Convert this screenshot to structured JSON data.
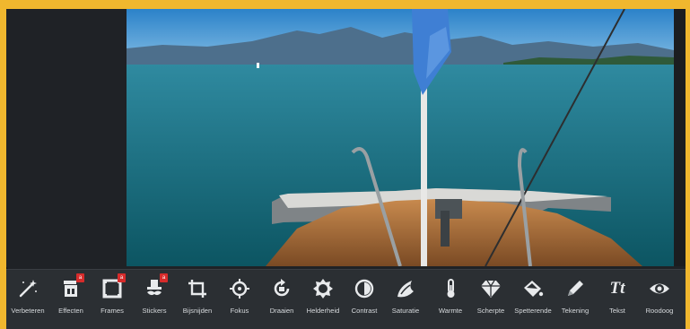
{
  "toolbar": {
    "tools": [
      {
        "label": "Verbeteren",
        "icon": "magic-wand-icon"
      },
      {
        "label": "Effecten",
        "icon": "effects-icon",
        "badge": "a"
      },
      {
        "label": "Frames",
        "icon": "frames-icon",
        "badge": "a"
      },
      {
        "label": "Stickers",
        "icon": "stickers-icon",
        "badge": "a"
      },
      {
        "label": "Bijsnijden",
        "icon": "crop-icon"
      },
      {
        "label": "Fokus",
        "icon": "focus-icon"
      },
      {
        "label": "Draaien",
        "icon": "rotate-icon"
      },
      {
        "label": "Helderheid",
        "icon": "brightness-icon"
      },
      {
        "label": "Contrast",
        "icon": "contrast-icon"
      },
      {
        "label": "Saturatie",
        "icon": "saturation-icon"
      },
      {
        "label": "Warmte",
        "icon": "thermometer-icon"
      },
      {
        "label": "Scherpte",
        "icon": "diamond-icon"
      },
      {
        "label": "Spetterende",
        "icon": "paint-bucket-icon"
      },
      {
        "label": "Tekening",
        "icon": "pencil-icon"
      },
      {
        "label": "Tekst",
        "icon": "text-icon",
        "glyph": "Tt"
      },
      {
        "label": "Roodoog",
        "icon": "eye-icon"
      }
    ]
  },
  "colors": {
    "frame": "#f0b72e",
    "app_bg": "#1f2226",
    "toolbar_bg": "#2b2f33",
    "badge": "#d72b2b",
    "icon": "#e8eaec"
  }
}
